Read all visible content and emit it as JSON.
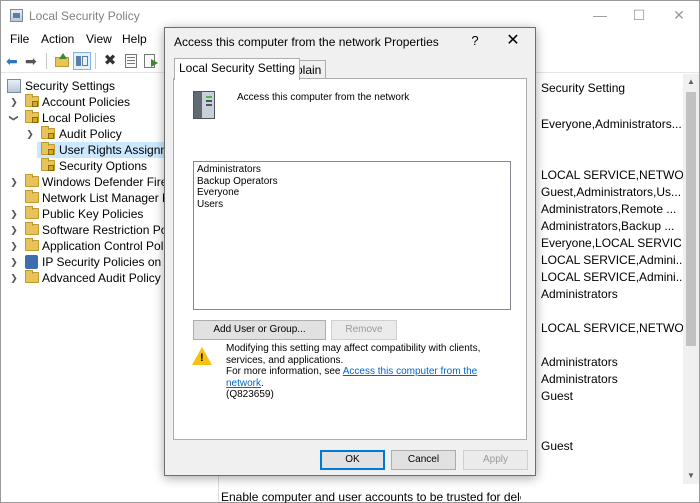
{
  "window": {
    "title": "Local Security Policy",
    "minimize_glyph": "—",
    "maximize_glyph": "☐",
    "close_glyph": "✕"
  },
  "menu": [
    "File",
    "Action",
    "View",
    "Help"
  ],
  "toolbar": {
    "back_glyph": "⬅",
    "forward_glyph": "➡",
    "delete_glyph": "✖"
  },
  "tree": {
    "root": "Security Settings",
    "items": [
      {
        "label": "Account Policies"
      },
      {
        "label": "Local Policies"
      },
      {
        "label": "Audit Policy"
      },
      {
        "label": "User Rights Assignmen"
      },
      {
        "label": "Security Options"
      },
      {
        "label": "Windows Defender Firewal"
      },
      {
        "label": "Network List Manager Poli"
      },
      {
        "label": "Public Key Policies"
      },
      {
        "label": "Software Restriction Policie"
      },
      {
        "label": "Application Control Policie"
      },
      {
        "label": "IP Security Policies on Loca"
      },
      {
        "label": "Advanced Audit Policy Co"
      }
    ]
  },
  "list": {
    "header": "Security Setting",
    "values": [
      "Everyone,Administrators...",
      "LOCAL SERVICE,NETWO...",
      "Guest,Administrators,Us...",
      "Administrators,Remote ...",
      "Administrators,Backup ...",
      "Everyone,LOCAL SERVIC...",
      "LOCAL SERVICE,Admini...",
      "LOCAL SERVICE,Admini...",
      "Administrators",
      "LOCAL SERVICE,NETWO...",
      "Administrators",
      "Administrators",
      "Guest",
      "Guest"
    ],
    "bottom_row": "Enable computer and user accounts to be trusted for delega"
  },
  "scrollbar": {
    "up_glyph": "▲",
    "down_glyph": "▼"
  },
  "dialog": {
    "title": "Access this computer from the network Properties",
    "help_glyph": "?",
    "close_glyph": "✕",
    "tabs": [
      "Local Security Setting",
      "Explain"
    ],
    "policy_name": "Access this computer from the network",
    "members": [
      "Administrators",
      "Backup Operators",
      "Everyone",
      "Users"
    ],
    "add_button": "Add User or Group...",
    "remove_button": "Remove",
    "warning_icon_glyph": "!",
    "warning_line1": "Modifying this setting may affect compatibility with clients, services, and applications.",
    "warning_line2_prefix": "For more information, see ",
    "warning_link": "Access this computer from the network",
    "warning_line2_suffix": ".",
    "warning_line3": "(Q823659)",
    "ok_button": "OK",
    "cancel_button": "Cancel",
    "apply_button": "Apply"
  }
}
